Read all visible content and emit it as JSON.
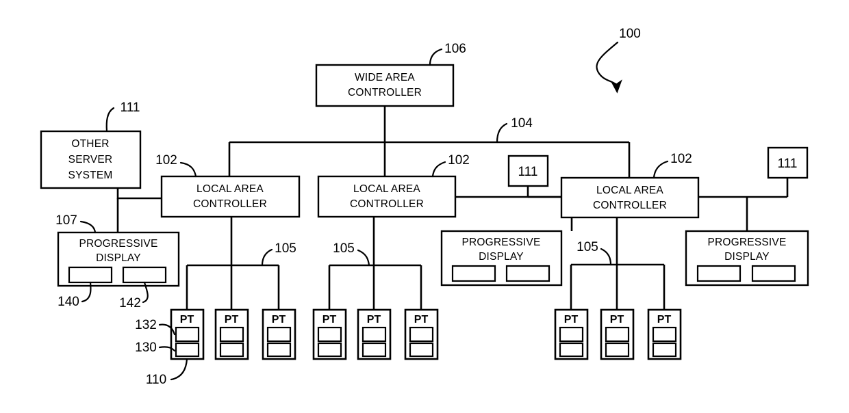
{
  "figure": {
    "title_ref": "100",
    "nodes": {
      "wide_area_controller": {
        "line1": "WIDE AREA",
        "line2": "CONTROLLER",
        "ref": "106"
      },
      "other_server_system": {
        "line1": "OTHER",
        "line2": "SERVER",
        "line3": "SYSTEM",
        "ref": "111"
      },
      "local_area_controller_1": {
        "line1": "LOCAL AREA",
        "line2": "CONTROLLER",
        "ref": "102"
      },
      "local_area_controller_2": {
        "line1": "LOCAL AREA",
        "line2": "CONTROLLER",
        "ref": "102"
      },
      "local_area_controller_3": {
        "line1": "LOCAL AREA",
        "line2": "CONTROLLER",
        "ref": "102"
      },
      "progressive_display_1": {
        "line1": "PROGRESSIVE",
        "line2": "DISPLAY",
        "ref": "107",
        "panel_left_ref": "140",
        "panel_right_ref": "142"
      },
      "progressive_display_2": {
        "line1": "PROGRESSIVE",
        "line2": "DISPLAY"
      },
      "progressive_display_3": {
        "line1": "PROGRESSIVE",
        "line2": "DISPLAY"
      },
      "server_box_2": {
        "label": "111"
      },
      "server_box_3": {
        "label": "111"
      }
    },
    "buses": {
      "wide_area_bus_ref": "104",
      "local_bus_1_ref": "105",
      "local_bus_2_ref": "105",
      "local_bus_3_ref": "105"
    },
    "player_terminals": {
      "label": "PT",
      "terminal_ref": "110",
      "upper_panel_ref": "132",
      "lower_panel_ref": "130",
      "groups": [
        {
          "name": "group-1",
          "count": 3
        },
        {
          "name": "group-2",
          "count": 3
        },
        {
          "name": "group-3",
          "count": 3
        }
      ]
    },
    "colors": {
      "ink": "#000000",
      "paper": "#ffffff"
    }
  }
}
